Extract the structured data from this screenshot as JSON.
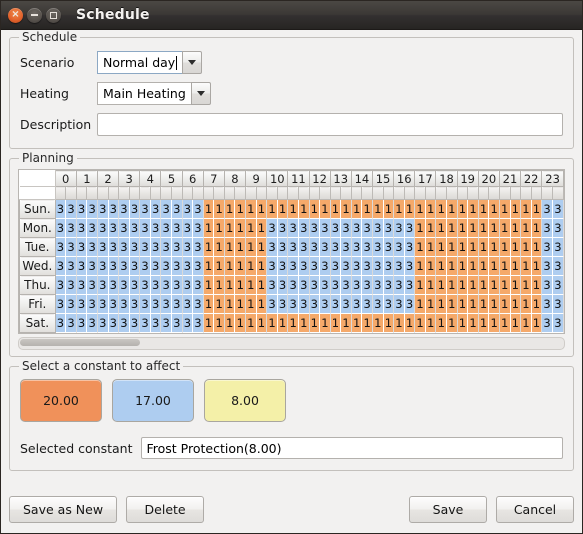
{
  "window": {
    "title": "Schedule",
    "controls": {
      "close": "×",
      "minimize": "minimize",
      "maximize": "maximize"
    }
  },
  "schedule_group": {
    "title": "Schedule",
    "scenario": {
      "label": "Scenario",
      "value": "Normal day"
    },
    "heating": {
      "label": "Heating",
      "value": "Main Heating"
    },
    "description": {
      "label": "Description",
      "value": "",
      "placeholder": ""
    }
  },
  "planning_group": {
    "title": "Planning",
    "hours": [
      "0",
      "1",
      "2",
      "3",
      "4",
      "5",
      "6",
      "7",
      "8",
      "9",
      "10",
      "11",
      "12",
      "13",
      "14",
      "15",
      "16",
      "17",
      "18",
      "19",
      "20",
      "21",
      "22",
      "23"
    ],
    "days": [
      "Sun.",
      "Mon.",
      "Tue.",
      "Wed.",
      "Thu.",
      "Fri.",
      "Sat."
    ],
    "slot_colors": {
      "1": "#f5a96a",
      "3": "#aecdf0",
      "2": "#f4f0a8"
    },
    "schedule_values": {
      "Sun.": [
        "3",
        "3",
        "3",
        "3",
        "3",
        "3",
        "3",
        "3",
        "3",
        "3",
        "3",
        "3",
        "3",
        "3",
        "1",
        "1",
        "1",
        "1",
        "1",
        "1",
        "1",
        "1",
        "1",
        "1",
        "1",
        "1",
        "1",
        "1",
        "1",
        "1",
        "1",
        "1",
        "1",
        "1",
        "1",
        "1",
        "1",
        "1",
        "1",
        "1",
        "1",
        "1",
        "1",
        "1",
        "1",
        "1",
        "3",
        "3"
      ],
      "Mon.": [
        "3",
        "3",
        "3",
        "3",
        "3",
        "3",
        "3",
        "3",
        "3",
        "3",
        "3",
        "3",
        "3",
        "3",
        "1",
        "1",
        "1",
        "1",
        "1",
        "1",
        "3",
        "3",
        "3",
        "3",
        "3",
        "3",
        "3",
        "3",
        "3",
        "3",
        "3",
        "3",
        "3",
        "3",
        "1",
        "1",
        "1",
        "1",
        "1",
        "1",
        "1",
        "1",
        "1",
        "1",
        "1",
        "1",
        "3",
        "3"
      ],
      "Tue.": [
        "3",
        "3",
        "3",
        "3",
        "3",
        "3",
        "3",
        "3",
        "3",
        "3",
        "3",
        "3",
        "3",
        "3",
        "1",
        "1",
        "1",
        "1",
        "1",
        "1",
        "3",
        "3",
        "3",
        "3",
        "3",
        "3",
        "3",
        "3",
        "3",
        "3",
        "3",
        "3",
        "3",
        "3",
        "1",
        "1",
        "1",
        "1",
        "1",
        "1",
        "1",
        "1",
        "1",
        "1",
        "1",
        "1",
        "3",
        "3"
      ],
      "Wed.": [
        "3",
        "3",
        "3",
        "3",
        "3",
        "3",
        "3",
        "3",
        "3",
        "3",
        "3",
        "3",
        "3",
        "3",
        "1",
        "1",
        "1",
        "1",
        "1",
        "1",
        "3",
        "3",
        "3",
        "3",
        "3",
        "3",
        "3",
        "3",
        "3",
        "3",
        "3",
        "3",
        "3",
        "3",
        "1",
        "1",
        "1",
        "1",
        "1",
        "1",
        "1",
        "1",
        "1",
        "1",
        "1",
        "1",
        "3",
        "3"
      ],
      "Thu.": [
        "3",
        "3",
        "3",
        "3",
        "3",
        "3",
        "3",
        "3",
        "3",
        "3",
        "3",
        "3",
        "3",
        "3",
        "1",
        "1",
        "1",
        "1",
        "1",
        "1",
        "3",
        "3",
        "3",
        "3",
        "3",
        "3",
        "3",
        "3",
        "3",
        "3",
        "3",
        "3",
        "3",
        "3",
        "1",
        "1",
        "1",
        "1",
        "1",
        "1",
        "1",
        "1",
        "1",
        "1",
        "1",
        "1",
        "3",
        "3"
      ],
      "Fri.": [
        "3",
        "3",
        "3",
        "3",
        "3",
        "3",
        "3",
        "3",
        "3",
        "3",
        "3",
        "3",
        "3",
        "3",
        "1",
        "1",
        "1",
        "1",
        "1",
        "1",
        "3",
        "3",
        "3",
        "3",
        "3",
        "3",
        "3",
        "3",
        "3",
        "3",
        "3",
        "3",
        "3",
        "3",
        "1",
        "1",
        "1",
        "1",
        "1",
        "1",
        "1",
        "1",
        "1",
        "1",
        "1",
        "1",
        "3",
        "3"
      ],
      "Sat.": [
        "3",
        "3",
        "3",
        "3",
        "3",
        "3",
        "3",
        "3",
        "3",
        "3",
        "3",
        "3",
        "3",
        "3",
        "1",
        "1",
        "1",
        "1",
        "1",
        "1",
        "1",
        "1",
        "1",
        "1",
        "1",
        "1",
        "1",
        "1",
        "1",
        "1",
        "1",
        "1",
        "1",
        "1",
        "1",
        "1",
        "1",
        "1",
        "1",
        "1",
        "1",
        "1",
        "1",
        "1",
        "1",
        "1",
        "3",
        "3"
      ]
    }
  },
  "constants_group": {
    "title": "Select a constant to affect",
    "buttons": [
      {
        "value": "20.00",
        "color": "#f0915a"
      },
      {
        "value": "17.00",
        "color": "#aecdf0"
      },
      {
        "value": "8.00",
        "color": "#f4f0a8"
      }
    ],
    "selected": {
      "label": "Selected constant",
      "value": "Frost Protection(8.00)"
    }
  },
  "footer": {
    "save_as_new": "Save as New",
    "delete": "Delete",
    "save": "Save",
    "cancel": "Cancel"
  }
}
